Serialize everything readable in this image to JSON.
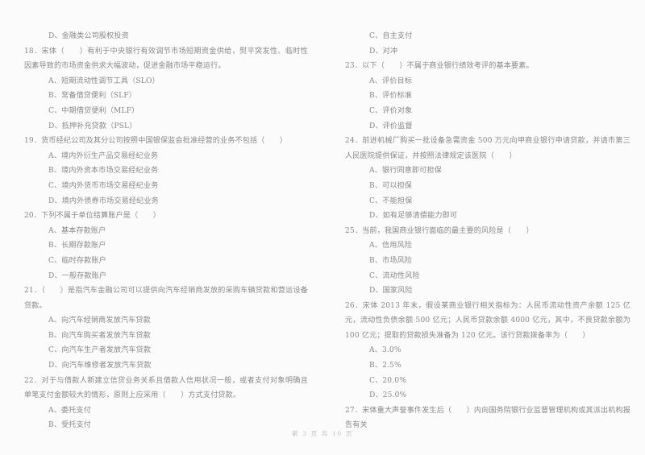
{
  "document": {
    "kind": "scanned-exam-page",
    "footer": "第 3 页  共 10 页",
    "page_number": "3",
    "total_pages": "10"
  },
  "left_column": {
    "items": [
      {
        "type": "option",
        "name": "option-q17-d",
        "text": "D、金融类公司股权投资"
      },
      {
        "type": "question",
        "name": "question-18",
        "text": "18．宋体（　　）有利于中央银行有效调节市场短期资金供给，熨平突发性、临时性因素导致的市场资金供求大幅波动，促进金融市场平稳运行。"
      },
      {
        "type": "option",
        "name": "option-q18-a",
        "text": "A、短期流动性调节工具（SLO）"
      },
      {
        "type": "option",
        "name": "option-q18-b",
        "text": "B、常备借贷便利（SLF）"
      },
      {
        "type": "option",
        "name": "option-q18-c",
        "text": "C、中期借贷便利（MLF）"
      },
      {
        "type": "option",
        "name": "option-q18-d",
        "text": "D、抵押补充贷款（PSL）"
      },
      {
        "type": "question",
        "name": "question-19",
        "text": "19．货币经纪公司及其分公司按照中国银保监会批准经营的业务不包括（　　）"
      },
      {
        "type": "option",
        "name": "option-q19-a",
        "text": "A、境内外衍生产品交易经纪业务"
      },
      {
        "type": "option",
        "name": "option-q19-b",
        "text": "B、境内外资本市场交易经纪业务"
      },
      {
        "type": "option",
        "name": "option-q19-c",
        "text": "C、境内外货币市场交易经纪业务"
      },
      {
        "type": "option",
        "name": "option-q19-d",
        "text": "D、境内外债券市场交易经纪业务"
      },
      {
        "type": "question",
        "name": "question-20",
        "text": "20．下列不属于单位结算账户是（　　）"
      },
      {
        "type": "option",
        "name": "option-q20-a",
        "text": "A、基本存款账户"
      },
      {
        "type": "option",
        "name": "option-q20-b",
        "text": "B、长期存款账户"
      },
      {
        "type": "option",
        "name": "option-q20-c",
        "text": "C、临时存款账户"
      },
      {
        "type": "option",
        "name": "option-q20-d",
        "text": "D、一般存款账户"
      },
      {
        "type": "question",
        "name": "question-21",
        "text": "21．（　　）是指汽车金融公司可以提供向汽车经销商发放的采购车辆贷款和营运设备贷款。"
      },
      {
        "type": "option",
        "name": "option-q21-a",
        "text": "A、向汽车经销商发放汽车贷款"
      },
      {
        "type": "option",
        "name": "option-q21-b",
        "text": "B、向汽车购买者发放汽车贷款"
      },
      {
        "type": "option",
        "name": "option-q21-c",
        "text": "C、向汽车生产者发放汽车贷款"
      },
      {
        "type": "option",
        "name": "option-q21-d",
        "text": "D、向汽车维修者发放汽车贷款"
      },
      {
        "type": "question",
        "name": "question-22",
        "text": "22．对于与借款人新建立信贷业务关系且借款人信用状况一般，或者支付对象明确且单笔支付金额较大的情形，原则上应采用（　　）方式支付贷款。"
      },
      {
        "type": "option",
        "name": "option-q22-a",
        "text": "A、委托支付"
      },
      {
        "type": "option",
        "name": "option-q22-b",
        "text": "B、受托支付"
      }
    ]
  },
  "right_column": {
    "items": [
      {
        "type": "option",
        "name": "option-q22-c",
        "text": "C、自主支付"
      },
      {
        "type": "option",
        "name": "option-q22-d",
        "text": "D、对冲"
      },
      {
        "type": "question",
        "name": "question-23",
        "text": "23．以下（　　）不属于商业银行绩效考评的基本要素。"
      },
      {
        "type": "option",
        "name": "option-q23-a",
        "text": "A、评价目标"
      },
      {
        "type": "option",
        "name": "option-q23-b",
        "text": "B、评价标准"
      },
      {
        "type": "option",
        "name": "option-q23-c",
        "text": "C、评价对象"
      },
      {
        "type": "option",
        "name": "option-q23-d",
        "text": "D、评价监督"
      },
      {
        "type": "question",
        "name": "question-24",
        "text": "24．前进机械厂购买一批设备急需资金 500 万元向甲商业银行申请贷款，并请市第三人民医院提供保证，并按照法律规定该医院（　　）"
      },
      {
        "type": "option",
        "name": "option-q24-a",
        "text": "A、银行同意即可担保"
      },
      {
        "type": "option",
        "name": "option-q24-b",
        "text": "B、可以担保"
      },
      {
        "type": "option",
        "name": "option-q24-c",
        "text": "C、不能担保"
      },
      {
        "type": "option",
        "name": "option-q24-d",
        "text": "D、如有足够清偿能力即可"
      },
      {
        "type": "question",
        "name": "question-25",
        "text": "25．当前，我国商业银行面临的最主要的风险是（　　）"
      },
      {
        "type": "option",
        "name": "option-q25-a",
        "text": "A、信用风险"
      },
      {
        "type": "option",
        "name": "option-q25-b",
        "text": "B、市场风险"
      },
      {
        "type": "option",
        "name": "option-q25-c",
        "text": "C、流动性风险"
      },
      {
        "type": "option",
        "name": "option-q25-d",
        "text": "D、国家风险"
      },
      {
        "type": "question",
        "name": "question-26",
        "text": "26．宋体 2013 年末，假设某商业银行相关指标为：人民币流动性资产余额 125 亿元，流动性负债余额 500 亿元；人民币贷款余额 4000 亿元，其中，不良贷款余额为 100 亿元；提取的贷款损失准备为 120 亿元。该行贷款拨备率为（　　）"
      },
      {
        "type": "option",
        "name": "option-q26-a",
        "text": "A、3.0%"
      },
      {
        "type": "option",
        "name": "option-q26-b",
        "text": "B、2.5%"
      },
      {
        "type": "option",
        "name": "option-q26-c",
        "text": "C、20.0%"
      },
      {
        "type": "option",
        "name": "option-q26-d",
        "text": "D、25.0%"
      },
      {
        "type": "question",
        "name": "question-27",
        "text": "27．宋体重大声誉事件发生后（　　）内向国务院银行业监督管理机构或其派出机构报告有关"
      }
    ]
  }
}
